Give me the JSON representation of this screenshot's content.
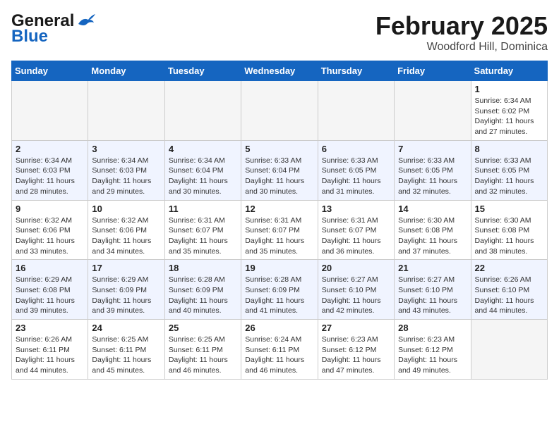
{
  "header": {
    "logo_line1": "General",
    "logo_line2": "Blue",
    "month": "February 2025",
    "location": "Woodford Hill, Dominica"
  },
  "days_of_week": [
    "Sunday",
    "Monday",
    "Tuesday",
    "Wednesday",
    "Thursday",
    "Friday",
    "Saturday"
  ],
  "weeks": [
    [
      {
        "day": null
      },
      {
        "day": null
      },
      {
        "day": null
      },
      {
        "day": null
      },
      {
        "day": null
      },
      {
        "day": null
      },
      {
        "day": 1,
        "sunrise": "6:34 AM",
        "sunset": "6:02 PM",
        "daylight": "11 hours and 27 minutes."
      }
    ],
    [
      {
        "day": 2,
        "sunrise": "6:34 AM",
        "sunset": "6:03 PM",
        "daylight": "11 hours and 28 minutes."
      },
      {
        "day": 3,
        "sunrise": "6:34 AM",
        "sunset": "6:03 PM",
        "daylight": "11 hours and 29 minutes."
      },
      {
        "day": 4,
        "sunrise": "6:34 AM",
        "sunset": "6:04 PM",
        "daylight": "11 hours and 30 minutes."
      },
      {
        "day": 5,
        "sunrise": "6:33 AM",
        "sunset": "6:04 PM",
        "daylight": "11 hours and 30 minutes."
      },
      {
        "day": 6,
        "sunrise": "6:33 AM",
        "sunset": "6:05 PM",
        "daylight": "11 hours and 31 minutes."
      },
      {
        "day": 7,
        "sunrise": "6:33 AM",
        "sunset": "6:05 PM",
        "daylight": "11 hours and 32 minutes."
      },
      {
        "day": 8,
        "sunrise": "6:33 AM",
        "sunset": "6:05 PM",
        "daylight": "11 hours and 32 minutes."
      }
    ],
    [
      {
        "day": 9,
        "sunrise": "6:32 AM",
        "sunset": "6:06 PM",
        "daylight": "11 hours and 33 minutes."
      },
      {
        "day": 10,
        "sunrise": "6:32 AM",
        "sunset": "6:06 PM",
        "daylight": "11 hours and 34 minutes."
      },
      {
        "day": 11,
        "sunrise": "6:31 AM",
        "sunset": "6:07 PM",
        "daylight": "11 hours and 35 minutes."
      },
      {
        "day": 12,
        "sunrise": "6:31 AM",
        "sunset": "6:07 PM",
        "daylight": "11 hours and 35 minutes."
      },
      {
        "day": 13,
        "sunrise": "6:31 AM",
        "sunset": "6:07 PM",
        "daylight": "11 hours and 36 minutes."
      },
      {
        "day": 14,
        "sunrise": "6:30 AM",
        "sunset": "6:08 PM",
        "daylight": "11 hours and 37 minutes."
      },
      {
        "day": 15,
        "sunrise": "6:30 AM",
        "sunset": "6:08 PM",
        "daylight": "11 hours and 38 minutes."
      }
    ],
    [
      {
        "day": 16,
        "sunrise": "6:29 AM",
        "sunset": "6:08 PM",
        "daylight": "11 hours and 39 minutes."
      },
      {
        "day": 17,
        "sunrise": "6:29 AM",
        "sunset": "6:09 PM",
        "daylight": "11 hours and 39 minutes."
      },
      {
        "day": 18,
        "sunrise": "6:28 AM",
        "sunset": "6:09 PM",
        "daylight": "11 hours and 40 minutes."
      },
      {
        "day": 19,
        "sunrise": "6:28 AM",
        "sunset": "6:09 PM",
        "daylight": "11 hours and 41 minutes."
      },
      {
        "day": 20,
        "sunrise": "6:27 AM",
        "sunset": "6:10 PM",
        "daylight": "11 hours and 42 minutes."
      },
      {
        "day": 21,
        "sunrise": "6:27 AM",
        "sunset": "6:10 PM",
        "daylight": "11 hours and 43 minutes."
      },
      {
        "day": 22,
        "sunrise": "6:26 AM",
        "sunset": "6:10 PM",
        "daylight": "11 hours and 44 minutes."
      }
    ],
    [
      {
        "day": 23,
        "sunrise": "6:26 AM",
        "sunset": "6:11 PM",
        "daylight": "11 hours and 44 minutes."
      },
      {
        "day": 24,
        "sunrise": "6:25 AM",
        "sunset": "6:11 PM",
        "daylight": "11 hours and 45 minutes."
      },
      {
        "day": 25,
        "sunrise": "6:25 AM",
        "sunset": "6:11 PM",
        "daylight": "11 hours and 46 minutes."
      },
      {
        "day": 26,
        "sunrise": "6:24 AM",
        "sunset": "6:11 PM",
        "daylight": "11 hours and 46 minutes."
      },
      {
        "day": 27,
        "sunrise": "6:23 AM",
        "sunset": "6:12 PM",
        "daylight": "11 hours and 47 minutes."
      },
      {
        "day": 28,
        "sunrise": "6:23 AM",
        "sunset": "6:12 PM",
        "daylight": "11 hours and 49 minutes."
      },
      {
        "day": null
      }
    ]
  ]
}
